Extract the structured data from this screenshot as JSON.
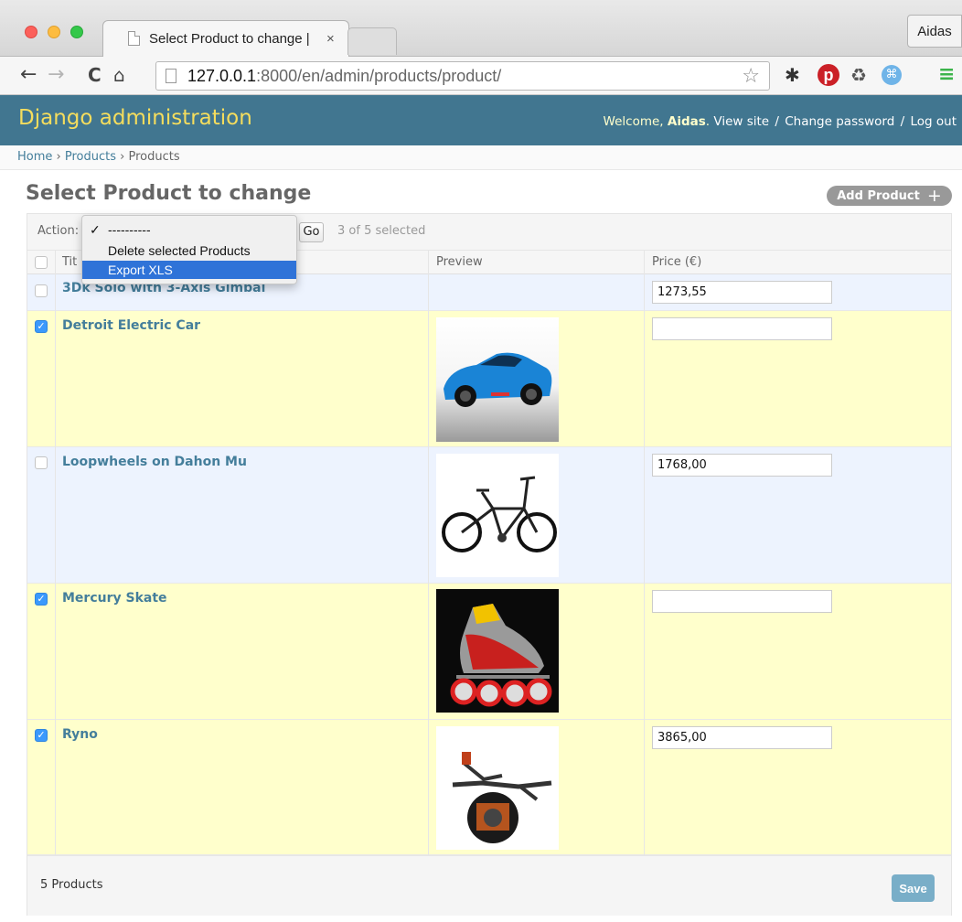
{
  "browser": {
    "tab_title": "Select Product to change |",
    "tab_close": "×",
    "profile_name": "Aidas",
    "url_host": "127.0.0.1",
    "url_rest": ":8000/en/admin/products/product/",
    "icons": [
      "back-icon",
      "forward-icon",
      "reload-icon",
      "home-icon",
      "star-icon",
      "gear-icon",
      "pinterest-icon",
      "recycle-icon",
      "command-icon",
      "menu-icon"
    ]
  },
  "header": {
    "branding": "Django administration",
    "welcome": "Welcome,",
    "username": "Aidas",
    "view_site": "View site",
    "change_password": "Change password",
    "log_out": "Log out",
    "separator": "/",
    "colors": {
      "bar": "#417690",
      "branding": "#f5dd5d"
    }
  },
  "breadcrumbs": {
    "home": "Home",
    "app": "Products",
    "current": "Products",
    "sep": "›"
  },
  "page": {
    "title": "Select Product to change",
    "add_button": "Add Product",
    "add_icon": "+"
  },
  "actions": {
    "label": "Action:",
    "go": "Go",
    "selected_text": "3 of 5 selected",
    "options": [
      {
        "label": "----------",
        "checked": true
      },
      {
        "label": "Delete selected Products",
        "checked": false
      },
      {
        "label": "Export XLS",
        "checked": false,
        "highlighted": true
      }
    ],
    "check_glyph": "✓"
  },
  "table": {
    "columns": [
      "Title",
      "Preview",
      "Price (€)"
    ],
    "column_partial": "Tit",
    "rows": [
      {
        "title": "3Dk Solo with 3-Axis Gimbal",
        "selected": false,
        "price": "1273,55",
        "preview": ""
      },
      {
        "title": "Detroit Electric Car",
        "selected": true,
        "price": "",
        "preview": "car"
      },
      {
        "title": "Loopwheels on Dahon Mu",
        "selected": false,
        "price": "1768,00",
        "preview": "bicycle"
      },
      {
        "title": "Mercury Skate",
        "selected": true,
        "price": "",
        "preview": "skate"
      },
      {
        "title": "Ryno",
        "selected": true,
        "price": "3865,00",
        "preview": "motorbike"
      }
    ]
  },
  "footer": {
    "count": "5 Products",
    "save": "Save"
  }
}
